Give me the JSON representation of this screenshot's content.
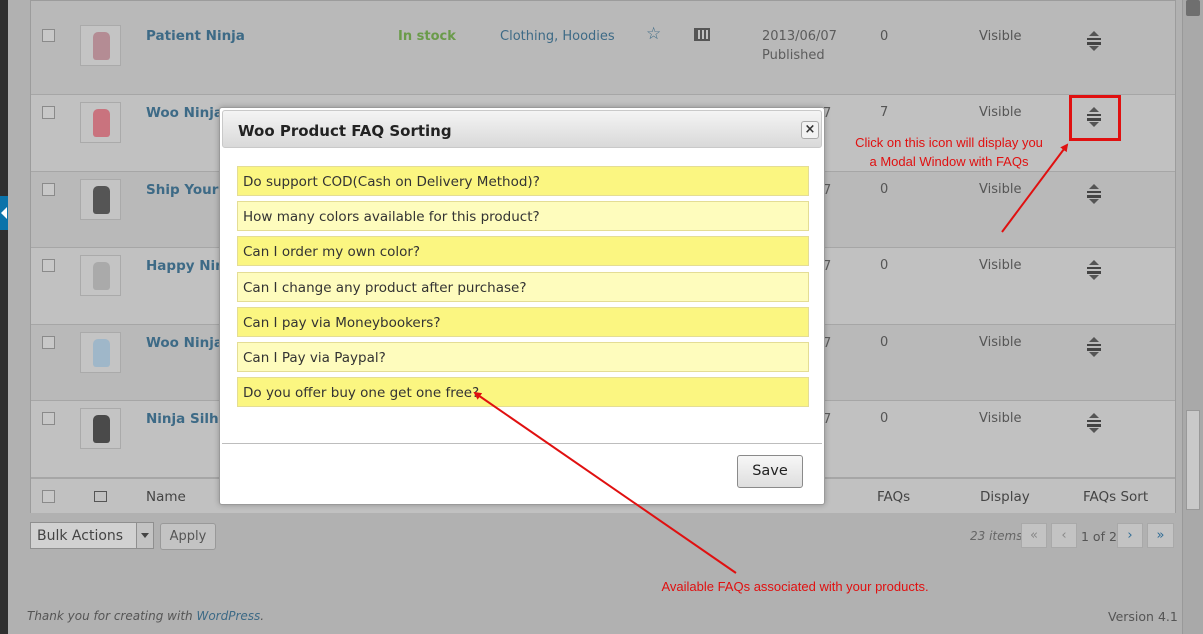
{
  "products": [
    {
      "name": "Patient Ninja",
      "stock": "In stock",
      "category": "Clothing, Hoodies",
      "date": "2013/06/07",
      "status": "Published",
      "faqs": "0",
      "visibility": "Visible",
      "color": "#b48c94"
    },
    {
      "name": "Woo Ninja",
      "date_tail": "7",
      "faqs": "7",
      "visibility": "Visible",
      "color": "#c9737e"
    },
    {
      "name": "Ship Your I",
      "date_tail": "7",
      "faqs": "0",
      "visibility": "Visible",
      "color": "#555555"
    },
    {
      "name": "Happy Ninj",
      "date_tail": "7",
      "faqs": "0",
      "visibility": "Visible",
      "color": "#aaaaaa"
    },
    {
      "name": "Woo Ninja",
      "date_tail": "7",
      "faqs": "0",
      "visibility": "Visible",
      "color": "#9fb7c9"
    },
    {
      "name": "Ninja Silho",
      "date_tail": "7",
      "faqs": "0",
      "visibility": "Visible",
      "color": "#4a4a4a"
    }
  ],
  "footer_headers": {
    "name": "Name",
    "faqs": "FAQs",
    "display": "Display",
    "faqs_sort": "FAQs Sort"
  },
  "bulk": {
    "label": "Bulk Actions",
    "apply": "Apply"
  },
  "pagination": {
    "items": "23 items",
    "first": "«",
    "prev": "‹",
    "info": "1 of 2",
    "next": "›",
    "last": "»"
  },
  "footer": {
    "thanks": "Thank you for creating with",
    "wordpress": "WordPress",
    "dot": ".",
    "version": "Version 4.1"
  },
  "modal": {
    "title": "Woo Product FAQ Sorting",
    "close": "×",
    "faqs": [
      "Do support COD(Cash on Delivery Method)?",
      "How many colors available for this product?",
      "Can I order my own color?",
      "Can I change any product after purchase?",
      "Can I pay via Moneybookers?",
      "Can I Pay via Paypal?",
      "Do you offer buy one get one free?"
    ],
    "save": "Save"
  },
  "annotations": {
    "icon_line1": "Click on this icon will display you",
    "icon_line2": "a Modal Window with FAQs",
    "faqs_note": "Available FAQs associated with your products.",
    "color": "#e01010"
  }
}
